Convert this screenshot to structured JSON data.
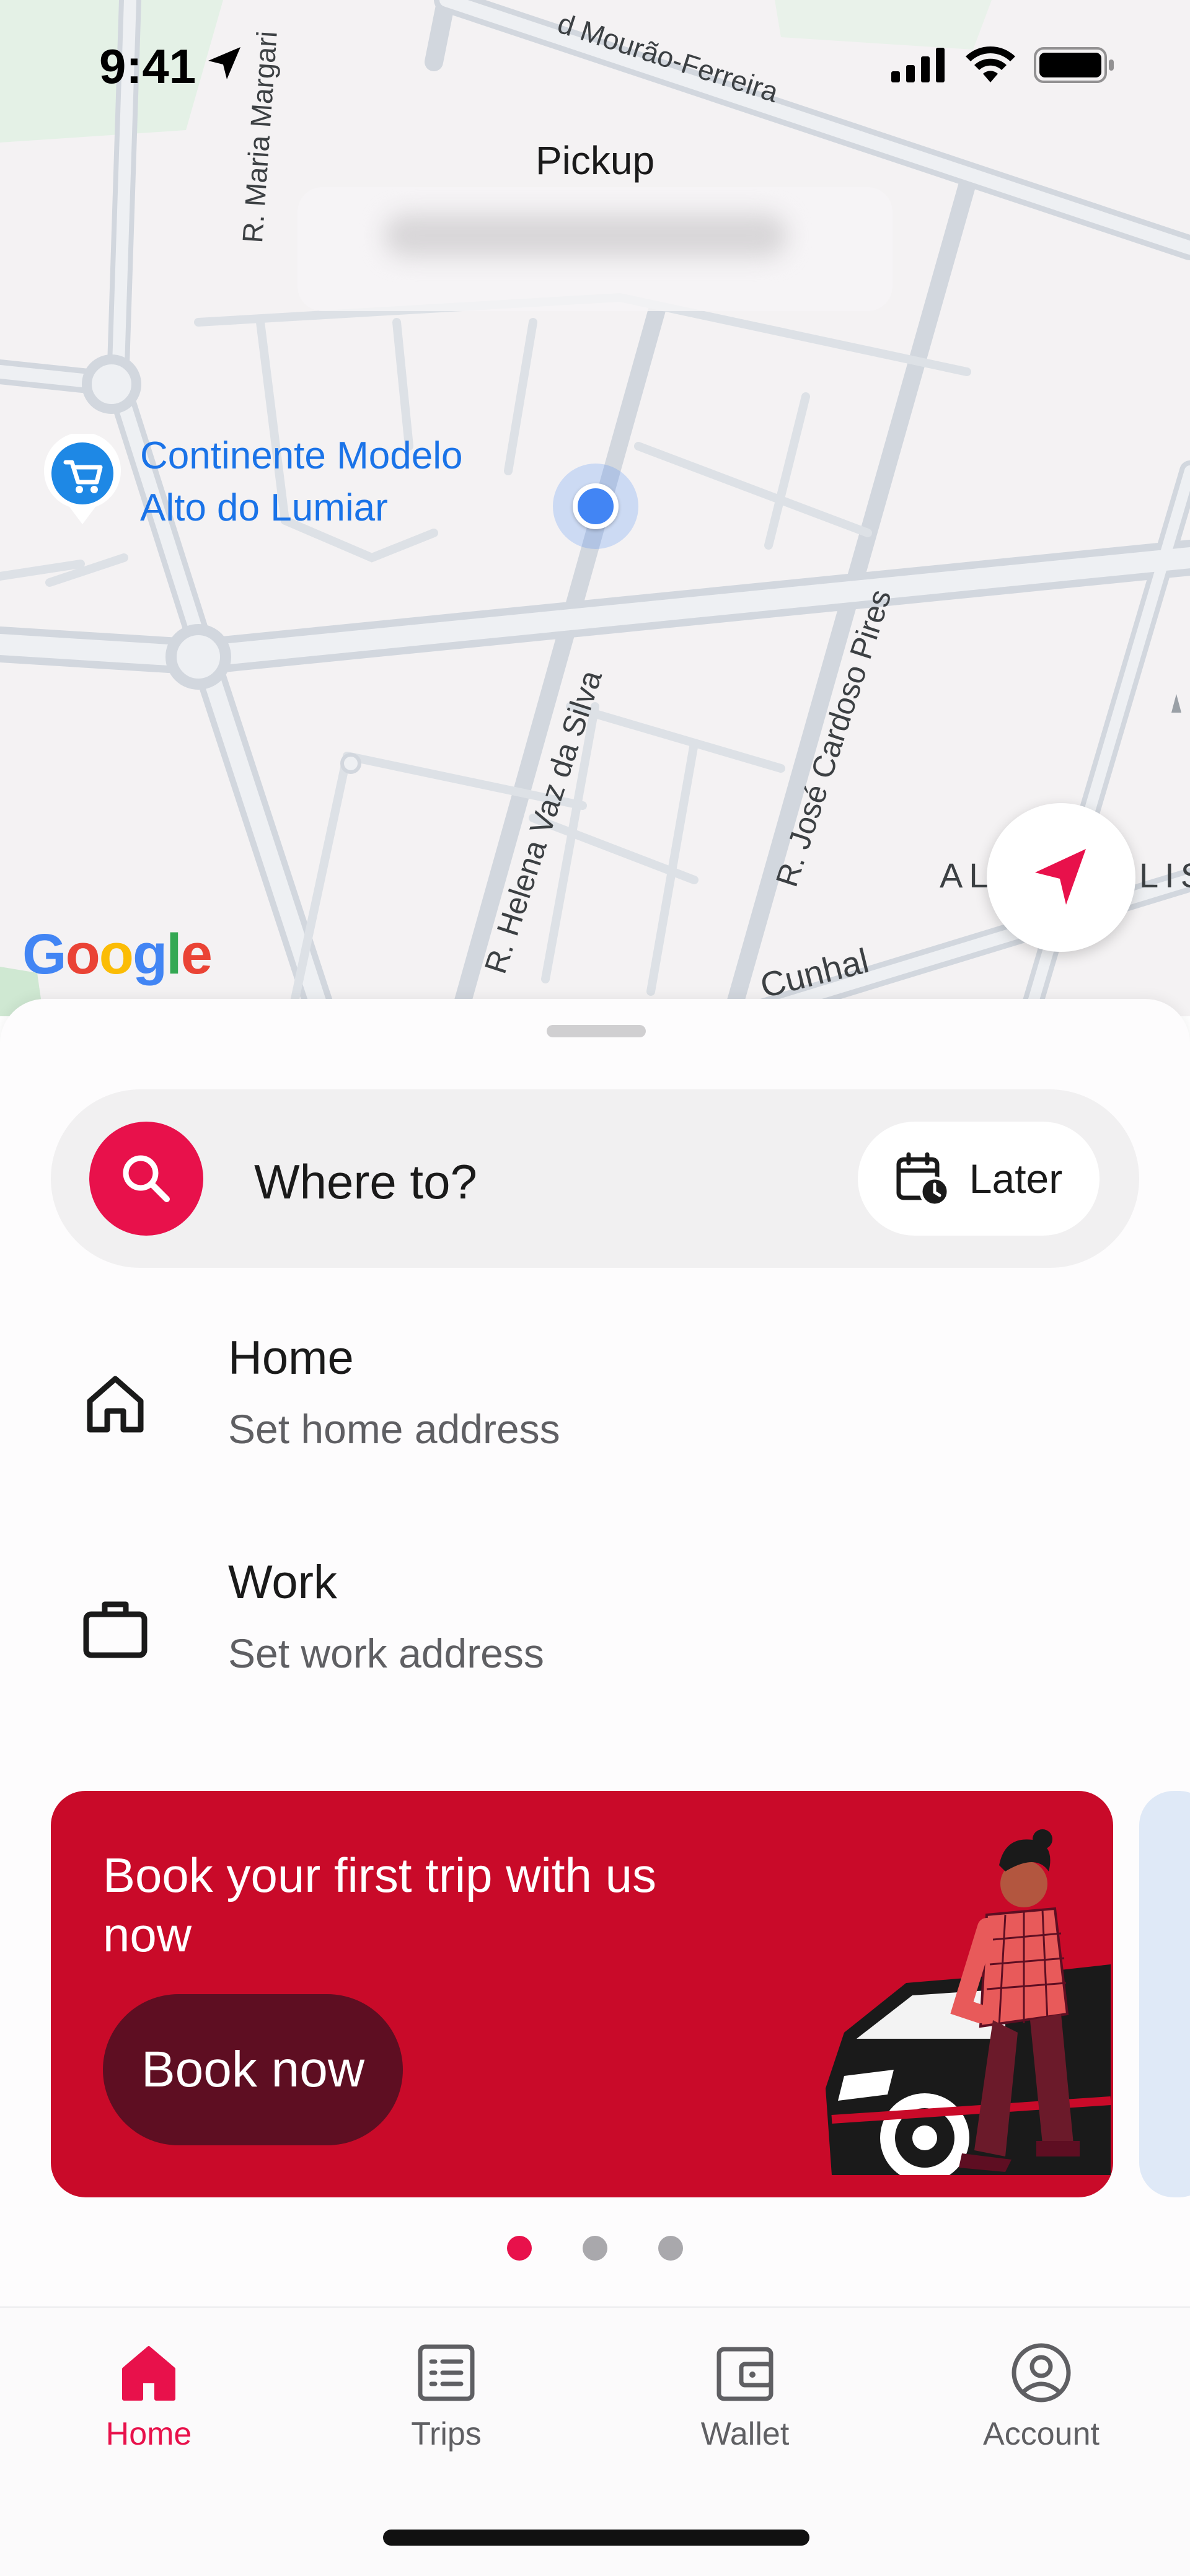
{
  "status_bar": {
    "time": "9:41"
  },
  "map": {
    "pickup_title": "Pickup",
    "poi_name_line1": "Continente Modelo",
    "poi_name_line2": "Alto do Lumiar",
    "streets": {
      "maria": "R. Maria Margari",
      "mourao": "d Mourão-Ferreira",
      "helena": "R. Helena Vaz da Silva",
      "jose": "R. José Cardoso Pires",
      "cunhal": "Cunhal",
      "al": "AL",
      "lis": "LIS"
    },
    "google_logo": [
      "G",
      "o",
      "o",
      "g",
      "l",
      "e"
    ],
    "google_colors": [
      "#4285f4",
      "#ea4335",
      "#fbbc05",
      "#4285f4",
      "#34a853",
      "#ea4335"
    ]
  },
  "search": {
    "placeholder": "Where to?",
    "later_label": "Later"
  },
  "places": [
    {
      "title": "Home",
      "subtitle": "Set home address",
      "icon": "home-outline-icon"
    },
    {
      "title": "Work",
      "subtitle": "Set work address",
      "icon": "briefcase-icon"
    }
  ],
  "promo": {
    "title": "Book your first trip with us now",
    "button_label": "Book now"
  },
  "carousel": {
    "total": 3,
    "active_index": 0
  },
  "tabs": [
    {
      "label": "Home",
      "icon": "home-filled-icon",
      "active": true
    },
    {
      "label": "Trips",
      "icon": "list-icon",
      "active": false
    },
    {
      "label": "Wallet",
      "icon": "wallet-icon",
      "active": false
    },
    {
      "label": "Account",
      "icon": "account-icon",
      "active": false
    }
  ],
  "colors": {
    "accent": "#e8114b",
    "promo_bg": "#c90a29",
    "promo_button": "#5e0e22",
    "map_link": "#1a73e8",
    "user_location": "#4285f4"
  }
}
